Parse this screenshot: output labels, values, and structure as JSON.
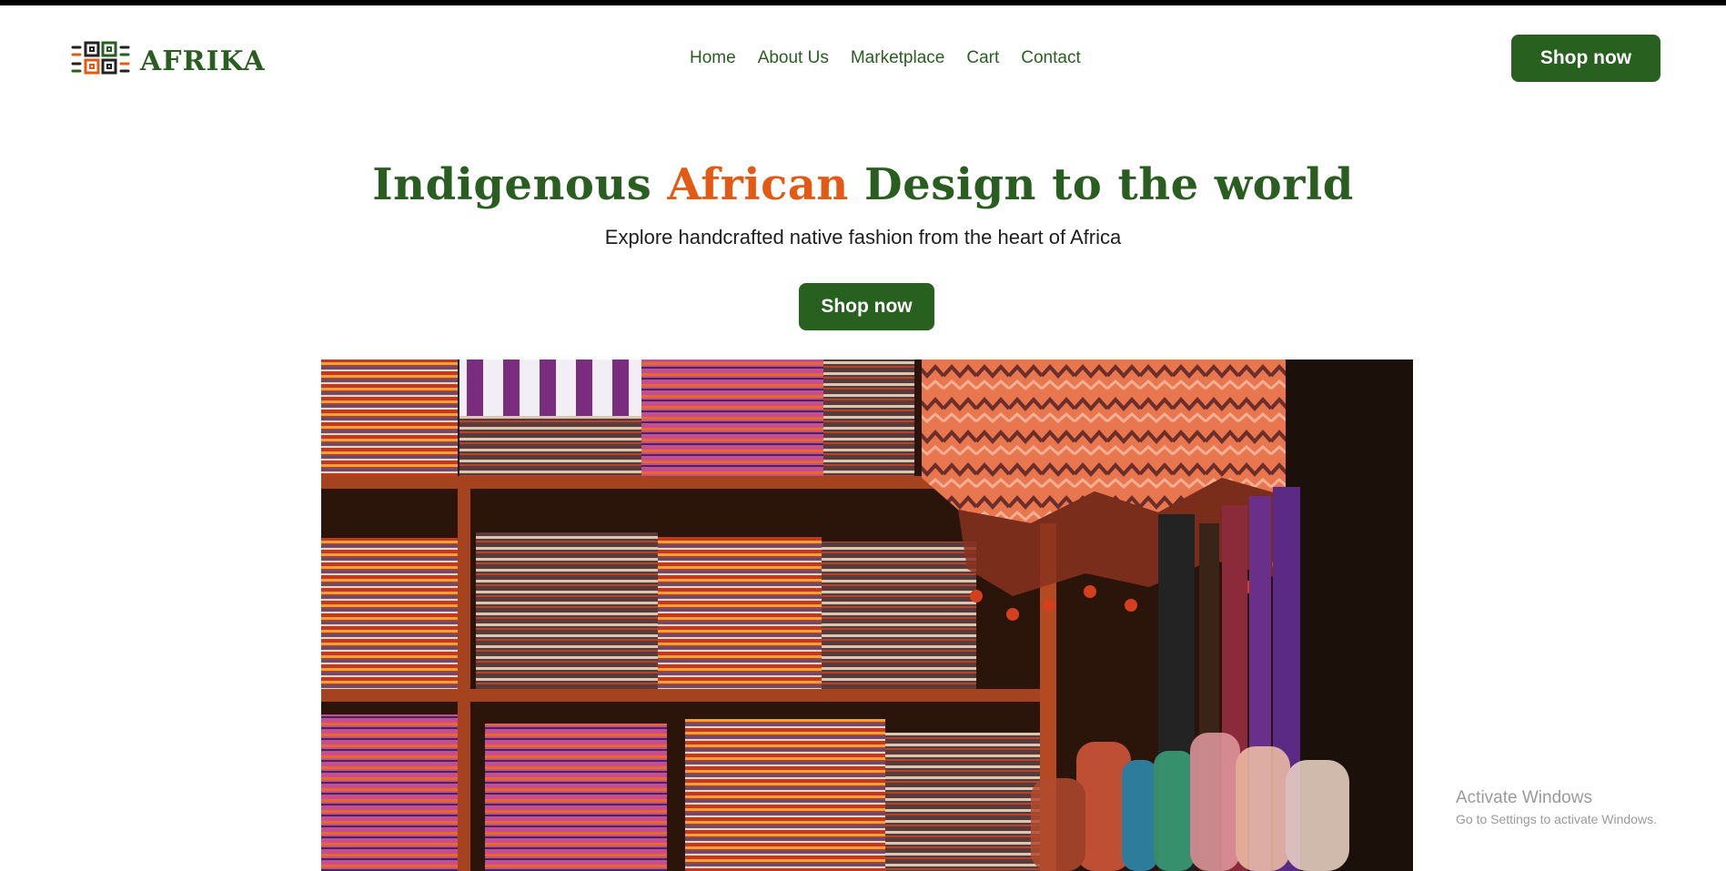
{
  "brand": {
    "name": "AFRIKA",
    "logo_icon": "afrika-pattern-logo-icon",
    "primary_color": "#28601f",
    "accent_color": "#e35a14"
  },
  "nav": {
    "items": [
      "Home",
      "About Us",
      "Marketplace",
      "Cart",
      "Contact"
    ]
  },
  "header": {
    "cta_label": "Shop now"
  },
  "hero": {
    "title_part1": "Indigenous ",
    "title_accent": "African",
    "title_part2": " Design to the world",
    "subtitle": "Explore handcrafted native fashion from the heart of Africa",
    "cta_label": "Shop now"
  },
  "watermark": {
    "line1": "Activate Windows",
    "line2": "Go to Settings to activate Windows."
  }
}
